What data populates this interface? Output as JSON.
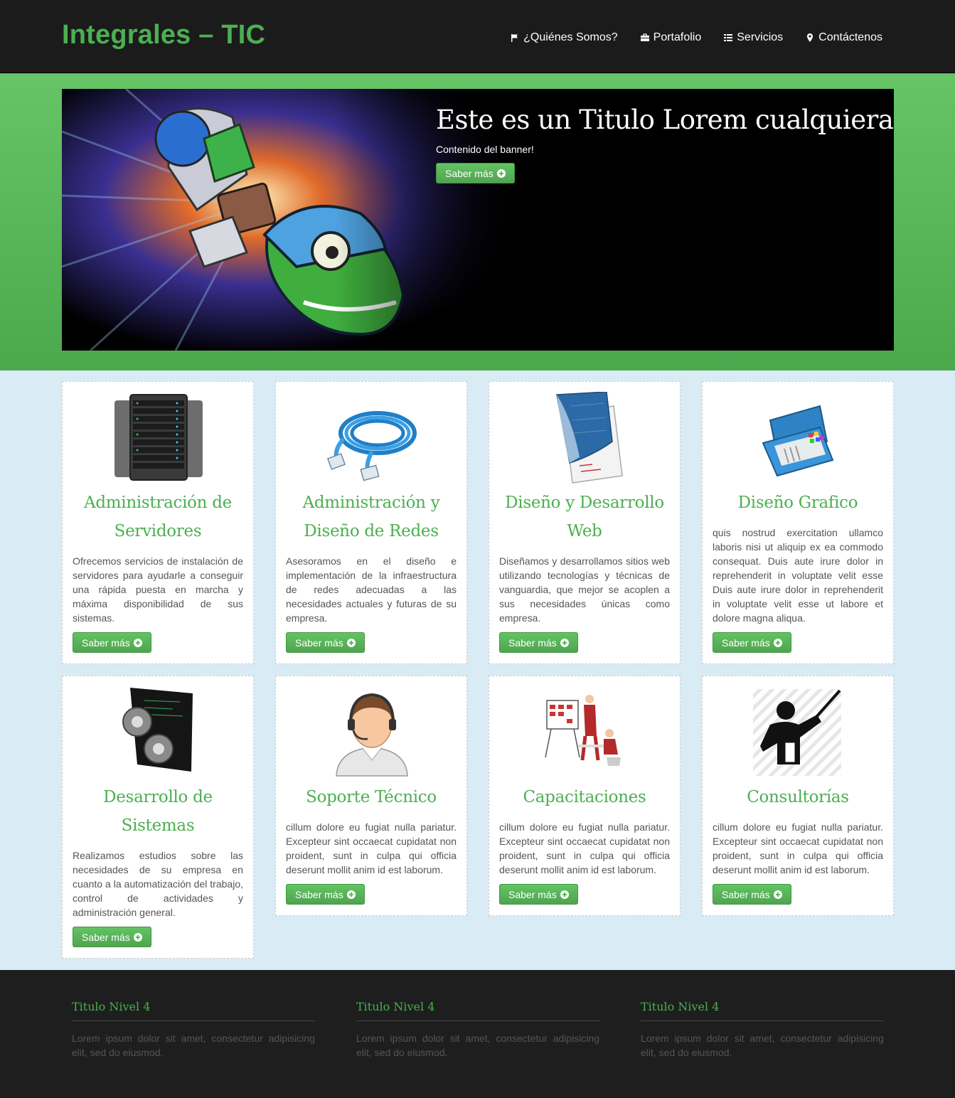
{
  "brand": "Integrales – TIC",
  "nav": [
    {
      "label": "¿Quiénes Somos?",
      "icon": "flag-icon"
    },
    {
      "label": "Portafolio",
      "icon": "briefcase-icon"
    },
    {
      "label": "Servicios",
      "icon": "list-icon"
    },
    {
      "label": "Contáctenos",
      "icon": "map-marker-icon"
    }
  ],
  "banner": {
    "title": "Este es un Titulo Lorem cualquiera",
    "text": "Contenido del banner!",
    "button": "Saber más"
  },
  "cards": [
    {
      "title": "Administración de Servidores",
      "text": "Ofrecemos servicios de instalación de servidores para ayudarle a conseguir una rápida puesta en marcha y máxima disponibilidad de sus sistemas.",
      "button": "Saber más",
      "icon": "server-rack-icon"
    },
    {
      "title": "Administración y Diseño de Redes",
      "text": "Asesoramos en el diseño e implementación de la infraestructura de redes adecuadas a las necesidades actuales y futuras de su empresa.",
      "button": "Saber más",
      "icon": "network-cable-icon"
    },
    {
      "title": "Diseño y Desarrollo Web",
      "text": "Diseñamos y desarrollamos sitios web utilizando tecnologías y técnicas de vanguardia, que mejor se acoplen a sus necesidades únicas como empresa.",
      "button": "Saber más",
      "icon": "web-page-icon"
    },
    {
      "title": "Diseño Grafico",
      "text": "quis nostrud exercitation ullamco laboris nisi ut aliquip ex ea commodo consequat. Duis aute irure dolor in reprehenderit in voluptate velit esse Duis aute irure dolor in reprehenderit in voluptate velit esse ut labore et dolore magna aliqua.",
      "button": "Saber más",
      "icon": "toolbox-icon"
    },
    {
      "title": "Desarrollo de Sistemas",
      "text": "Realizamos estudios sobre las necesidades de su empresa en cuanto a la automatización del trabajo, control de actividades y administración general.",
      "button": "Saber más",
      "icon": "gears-icon"
    },
    {
      "title": "Soporte Técnico",
      "text": "cillum dolore eu fugiat nulla pariatur. Excepteur sint occaecat cupidatat non proident, sunt in culpa qui officia deserunt mollit anim id est laborum.",
      "button": "Saber más",
      "icon": "headset-support-icon"
    },
    {
      "title": "Capacitaciones",
      "text": "cillum dolore eu fugiat nulla pariatur. Excepteur sint occaecat cupidatat non proident, sunt in culpa qui officia deserunt mollit anim id est laborum.",
      "button": "Saber más",
      "icon": "presentation-icon"
    },
    {
      "title": "Consultorías",
      "text": "cillum dolore eu fugiat nulla pariatur. Excepteur sint occaecat cupidatat non proident, sunt in culpa qui officia deserunt mollit anim id est laborum.",
      "button": "Saber más",
      "icon": "teacher-pointer-icon"
    }
  ],
  "footer": [
    {
      "title": "Titulo Nivel 4",
      "text": "Lorem ipsum dolor sit amet, consectetur adipisicing elit, sed do eiusmod."
    },
    {
      "title": "Titulo Nivel 4",
      "text": "Lorem ipsum dolor sit amet, consectetur adipisicing elit, sed do eiusmod."
    },
    {
      "title": "Titulo Nivel 4",
      "text": "Lorem ipsum dolor sit amet, consectetur adipisicing elit, sed do eiusmod."
    }
  ],
  "colors": {
    "accent": "#4caf50",
    "navbar": "#1b1b1b",
    "hero": "#5cb85c",
    "main_bg": "#d9ebf5",
    "footer": "#1e1e1e"
  }
}
